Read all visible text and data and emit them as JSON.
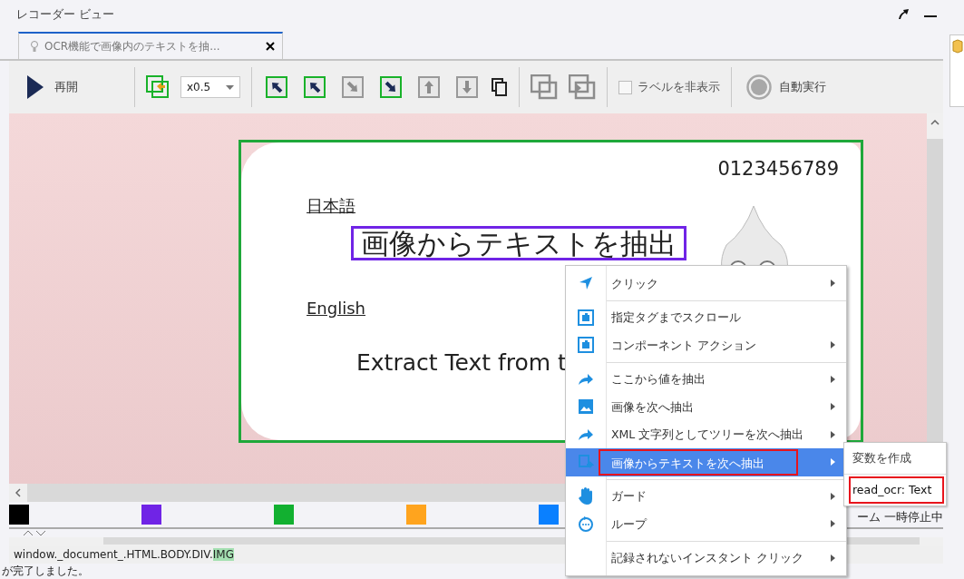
{
  "window": {
    "title": "レコーダー ビュー"
  },
  "tabs": [
    {
      "label": "OCR機能で画像内のテキストを抽...",
      "selected": true
    }
  ],
  "toolbar": {
    "resume": {
      "label": "再開"
    },
    "zoom": {
      "value": "x0.5"
    },
    "tools": [
      {
        "highlighted": true,
        "disabled": false
      },
      {
        "highlighted": true,
        "disabled": false
      },
      {
        "highlighted": false,
        "disabled": true
      },
      {
        "highlighted": true,
        "disabled": false
      },
      {
        "highlighted": false,
        "disabled": true
      },
      {
        "highlighted": false,
        "disabled": true
      }
    ],
    "hide_labels": {
      "label": "ラベルを非表示",
      "checked": false
    },
    "auto_run": {
      "label": "自動実行"
    }
  },
  "page_image": {
    "number": "0123456789",
    "japanese_heading": "日本語",
    "japanese_text": "画像からテキストを抽出",
    "english_heading": "English",
    "english_text": "Extract Text from t"
  },
  "swatches": [
    {
      "color": "#000000"
    },
    {
      "color": "#7024e6"
    },
    {
      "color": "#12b030"
    },
    {
      "color": "#ffa41e"
    },
    {
      "color": "#0a80ff"
    }
  ],
  "status_text": "ーム 一時停止中",
  "element_path": {
    "text": "window._document_.HTML.BODY.DIV.",
    "highlight": "IMG"
  },
  "message": "が完了しました。",
  "context_menu": {
    "items": [
      {
        "label": "クリック",
        "submenu": true,
        "selected": false,
        "separator_after": true
      },
      {
        "label": "指定タグまでスクロール",
        "submenu": false,
        "selected": false,
        "separator_after": false
      },
      {
        "label": "コンポーネント アクション",
        "submenu": true,
        "selected": false,
        "separator_after": true
      },
      {
        "label": "ここから値を抽出",
        "submenu": true,
        "selected": false,
        "separator_after": false
      },
      {
        "label": "画像を次へ抽出",
        "submenu": true,
        "selected": false,
        "separator_after": false
      },
      {
        "label": "XML 文字列としてツリーを次へ抽出",
        "submenu": true,
        "selected": false,
        "separator_after": false
      },
      {
        "label": "画像からテキストを次へ抽出",
        "submenu": true,
        "selected": true,
        "separator_after": true,
        "annotated": true
      },
      {
        "label": "ガード",
        "submenu": true,
        "selected": false,
        "separator_after": false
      },
      {
        "label": "ループ",
        "submenu": true,
        "selected": false,
        "separator_after": true
      },
      {
        "label": "記録されないインスタント クリック",
        "submenu": true,
        "selected": false,
        "separator_after": false
      }
    ],
    "submenu": [
      {
        "label": "変数を作成",
        "annotated": false
      },
      {
        "label": "read_ocr: Text",
        "annotated": true
      }
    ]
  }
}
